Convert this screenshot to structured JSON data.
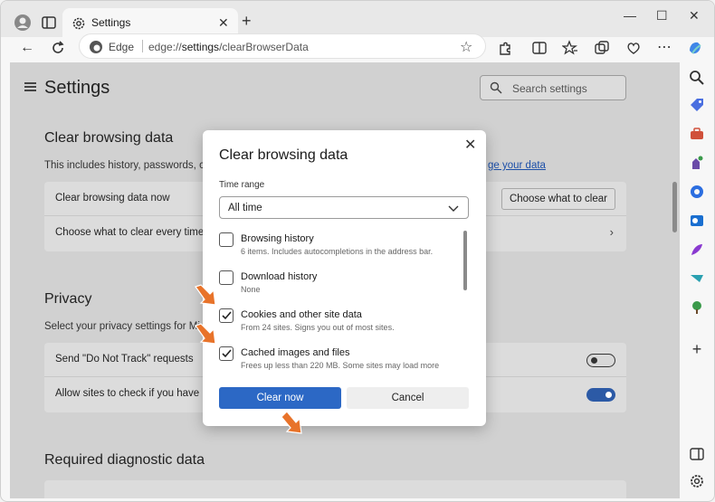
{
  "browser": {
    "tab_title": "Settings",
    "edge_label": "Edge",
    "url_prefix": "edge://",
    "url_strong": "settings",
    "url_suffix": "/clearBrowserData"
  },
  "page": {
    "title": "Settings",
    "search_placeholder": "Search settings",
    "clear_section": {
      "heading": "Clear browsing data",
      "description_start": "This includes history, passwords, coo",
      "description_link": "ge your data",
      "rows": [
        {
          "label": "Clear browsing data now",
          "button": "Choose what to clear"
        },
        {
          "label": "Choose what to clear every time"
        }
      ]
    },
    "privacy_section": {
      "heading": "Privacy",
      "description": "Select your privacy settings for Mi",
      "rows": [
        {
          "label": "Send \"Do Not Track\" requests",
          "toggle": "off"
        },
        {
          "label": "Allow sites to check if you have p",
          "toggle": "on"
        }
      ]
    },
    "diagnostic_section": {
      "heading": "Required diagnostic data"
    }
  },
  "dialog": {
    "title": "Clear browsing data",
    "time_range_label": "Time range",
    "time_range_value": "All time",
    "options": [
      {
        "label": "Browsing history",
        "sub": "6 items. Includes autocompletions in the address bar.",
        "checked": false
      },
      {
        "label": "Download history",
        "sub": "None",
        "checked": false
      },
      {
        "label": "Cookies and other site data",
        "sub": "From 24 sites. Signs you out of most sites.",
        "checked": true
      },
      {
        "label": "Cached images and files",
        "sub": "Frees up less than 220 MB. Some sites may load more",
        "checked": true
      }
    ],
    "primary_button": "Clear now",
    "secondary_button": "Cancel"
  },
  "colors": {
    "accent": "#2c68c5",
    "annotation_arrow": "#e8732a",
    "overlay": "#d1d1d1"
  }
}
